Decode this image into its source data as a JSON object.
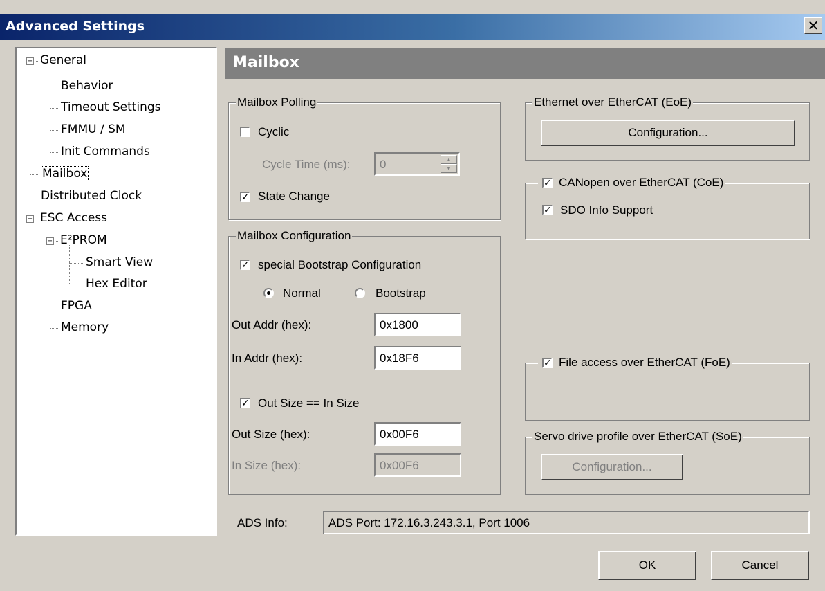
{
  "window": {
    "title": "Advanced Settings",
    "close_glyph": "✕"
  },
  "tree": {
    "general": "General",
    "behavior": "Behavior",
    "timeout": "Timeout Settings",
    "fmmu": "FMMU / SM",
    "init": "Init Commands",
    "mailbox": "Mailbox",
    "dc": "Distributed Clock",
    "esc": "ESC Access",
    "eeprom": "E²PROM",
    "smart": "Smart View",
    "hex": "Hex Editor",
    "fpga": "FPGA",
    "memory": "Memory",
    "collapse_glyph": "−"
  },
  "header": {
    "title": "Mailbox"
  },
  "polling": {
    "legend": "Mailbox Polling",
    "cyclic_label": "Cyclic",
    "cyclic_checked": false,
    "cycle_time_label": "Cycle Time (ms):",
    "cycle_time_value": "0",
    "state_change_label": "State Change",
    "state_change_checked": true
  },
  "config": {
    "legend": "Mailbox Configuration",
    "bootstrap_cfg_label": "special Bootstrap Configuration",
    "bootstrap_cfg_checked": true,
    "normal_label": "Normal",
    "bootstrap_label": "Bootstrap",
    "selected_mode": "Normal",
    "out_addr_label": "Out Addr (hex):",
    "out_addr_value": "0x1800",
    "in_addr_label": "In Addr (hex):",
    "in_addr_value": "0x18F6",
    "same_size_label": "Out Size == In Size",
    "same_size_checked": true,
    "out_size_label": "Out Size (hex):",
    "out_size_value": "0x00F6",
    "in_size_label": "In Size (hex):",
    "in_size_value": "0x00F6"
  },
  "eoe": {
    "legend": "Ethernet over EtherCAT (EoE)",
    "config_button": "Configuration..."
  },
  "coe": {
    "label": "CANopen over EtherCAT (CoE)",
    "checked": true,
    "sdo_label": "SDO Info Support",
    "sdo_checked": true
  },
  "foe": {
    "label": "File access over EtherCAT (FoE)",
    "checked": true
  },
  "soe": {
    "legend": "Servo drive profile over EtherCAT (SoE)",
    "config_button": "Configuration..."
  },
  "ads": {
    "label": "ADS Info:",
    "value": "ADS Port: 172.16.3.243.3.1, Port 1006"
  },
  "buttons": {
    "ok": "OK",
    "cancel": "Cancel"
  },
  "glyphs": {
    "check": "✓",
    "spin_up": "▲",
    "spin_down": "▼"
  }
}
